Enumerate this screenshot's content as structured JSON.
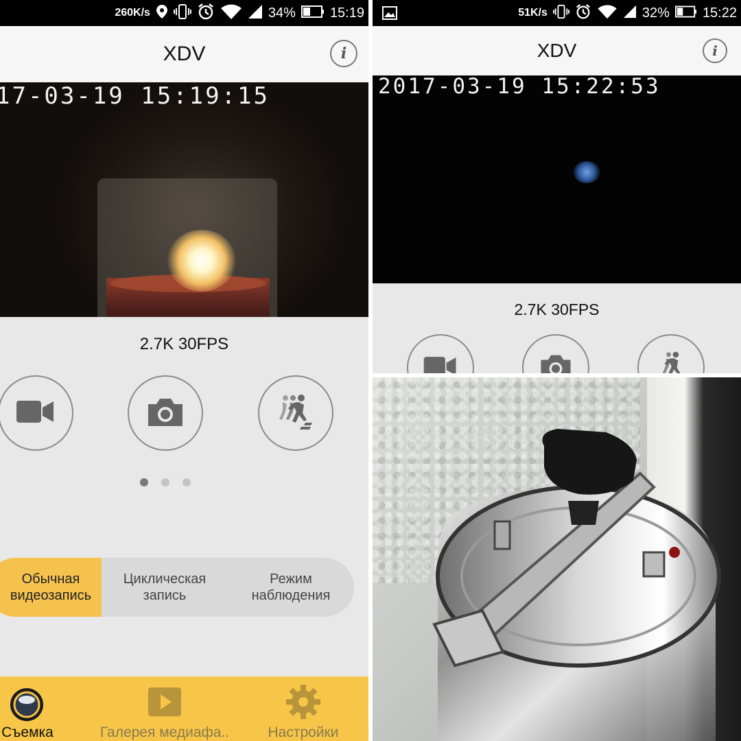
{
  "left": {
    "status": {
      "speed": "260K/s",
      "battery": "34%",
      "time": "15:19"
    },
    "app_title": "XDV",
    "timestamp": "17-03-19  15:19:15",
    "resolution": "2.7K  30FPS",
    "modes": {
      "selected": "Обычная видеозапись",
      "items": [
        {
          "line1": "Обычная",
          "line2": "видеозапись"
        },
        {
          "line1": "Циклическая",
          "line2": "запись"
        },
        {
          "line1": "Режим",
          "line2": "наблюдения"
        }
      ]
    },
    "nav": [
      {
        "label": "Съемка",
        "icon": "lens-icon"
      },
      {
        "label": "Галерея медиафа..",
        "icon": "play-icon"
      },
      {
        "label": "Настройки",
        "icon": "gear-icon"
      }
    ]
  },
  "right": {
    "status": {
      "speed": "51K/s",
      "battery": "32%",
      "time": "15:22"
    },
    "app_title": "XDV",
    "timestamp": "2017-03-19  15:22:53",
    "resolution": "2.7K  30FPS"
  },
  "colors": {
    "accent": "#f7c548",
    "segment_active": "#f5c24e",
    "background": "#e8e8e8",
    "icon_gray": "#666666"
  }
}
